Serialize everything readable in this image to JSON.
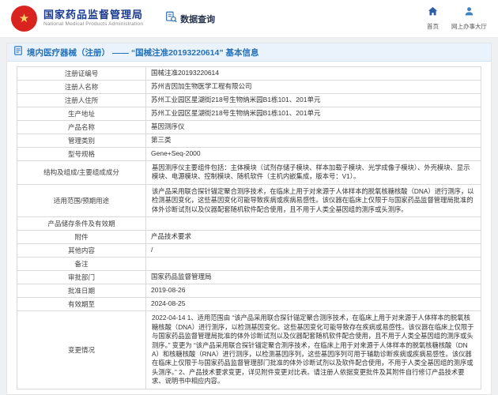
{
  "header": {
    "org_name_cn": "国家药品监督管理局",
    "org_name_en": "National Medical Products Administration",
    "data_query_label": "数据查询",
    "nav": {
      "home_label": "首页",
      "hall_label": "网上办事大厅"
    }
  },
  "page": {
    "title": "境内医疗器械（注册） —— “国械注准20193220614” 基本信息"
  },
  "colors": {
    "brand_red": "#d9231f",
    "accent_blue": "#2571b8"
  },
  "table": {
    "rows": [
      {
        "label": "注册证编号",
        "value": "国械注准20193220614"
      },
      {
        "label": "注册人名称",
        "value": "苏州吉因加生物医学工程有限公司"
      },
      {
        "label": "注册人住所",
        "value": "苏州工业园区星湖街218号生物纳米园B1栋101、201单元"
      },
      {
        "label": "生产地址",
        "value": "苏州工业园区星湖街218号生物纳米园B1栋101、201单元"
      },
      {
        "label": "产品名称",
        "value": "基因测序仪"
      },
      {
        "label": "管理类别",
        "value": "第三类"
      },
      {
        "label": "型号规格",
        "value": "Gene+Seq-2000"
      },
      {
        "label": "结构及组成/主要组成成分",
        "value": "基因测序仪主要组件包括：主体模块（试剂存储子模块、样本加载子模块、光学成像子模块）、外壳模块、显示模块、电源模块、控制模块、随机软件（主机内嵌集成，版本号：V1）。"
      },
      {
        "label": "适用范围/预期用途",
        "value": "该产品采用联合探针锚定聚合测序技术，在临床上用于对来源于人体样本的脱氧核糖核酸（DNA）进行测序，以检测基因变化，这些基因变化可能导致疾病或疾病易感性。该仪器在临床上仅限于与国家药品监督管理局批准的体外诊断试剂以及仪器配套随机软件配合使用，且不用于人类全基因组的测序或头测序。"
      },
      {
        "label": "产品储存条件及有效期",
        "value": ""
      },
      {
        "label": "附件",
        "value": "产品技术要求"
      },
      {
        "label": "其他内容",
        "value": "/"
      },
      {
        "label": "备注",
        "value": ""
      },
      {
        "label": "审批部门",
        "value": "国家药品监督管理局"
      },
      {
        "label": "批准日期",
        "value": "2019-08-26"
      },
      {
        "label": "有效期至",
        "value": "2024-08-25"
      },
      {
        "label": "变更情况",
        "value": "2022-04-14 1、适用范围由 “该产品采用联合探针锚定聚合测序技术，在临床上用于对来源于人体样本的脱氧核糖核酸（DNA）进行测序，以检测基因变化。这些基因变化可能导致存在疾病或易感性。该仪器在临床上仅限于与国家药品监督管理局批准的体外诊断试剂以及仪器配套随机软件配合使用，且不用于人类全基因组的测序或头测序。” 变更为 “该产品采用联合探针锚定聚合测序技术，在临床上用于对来源于人体样本的脱氧核糖核酸（DNA）和核糖核酸（RNA）进行测序，以检测基因序列，这些基因序列可用于辅助诊断疾病或疾病易感性。该仪器在临床上仅限于与国家药品监督管理部门批准的体外诊断试剂以及软件配合使用，不用于人类全基因组的测序或头测序。” 2、产品技术要求变更，详见附件变更对比表。请注册人依据变更批件及其附件自行修订产品技术要求、说明书中相应内容。"
      }
    ]
  }
}
